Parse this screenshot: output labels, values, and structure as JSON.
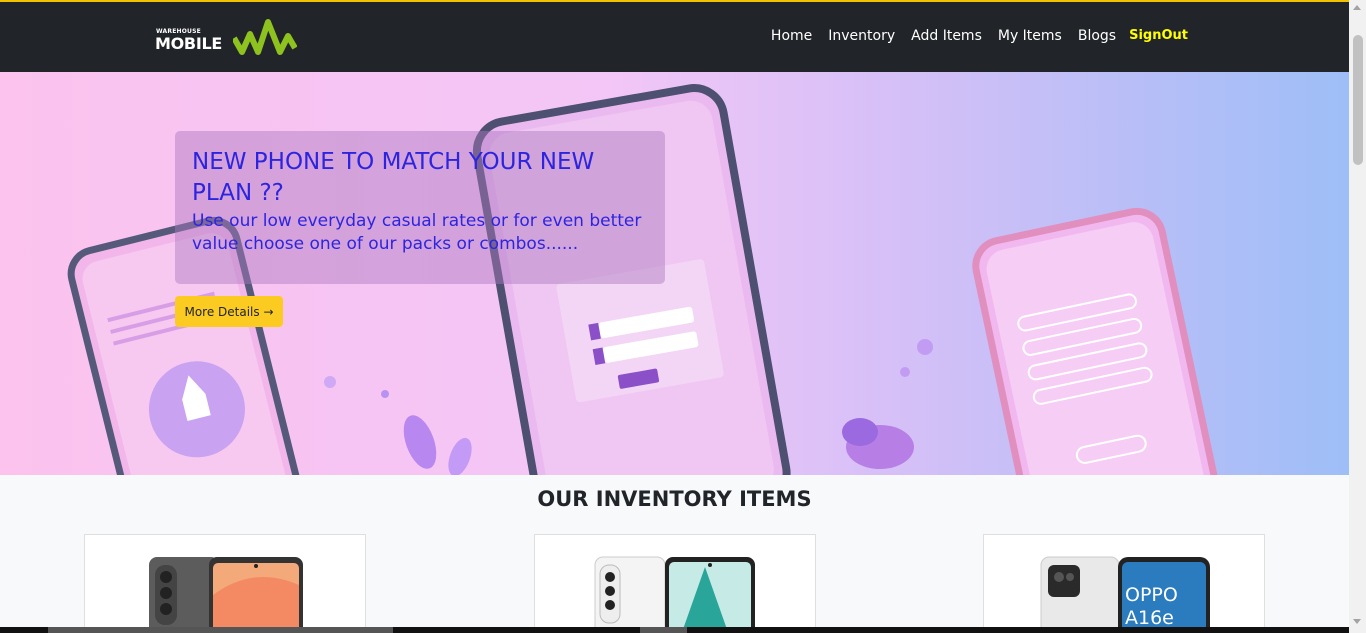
{
  "brand": {
    "logo_small": "WAREHOUSE",
    "logo_big": "MOBILE",
    "accent_color": "#8dc21f"
  },
  "nav": {
    "items": [
      "Home",
      "Inventory",
      "Add Items",
      "My Items",
      "Blogs"
    ],
    "signout": "SignOut"
  },
  "hero": {
    "title": "NEW PHONE TO MATCH YOUR NEW PLAN ??",
    "subtitle": "Use our low everyday casual rates or for even better value choose one of our packs or combos......",
    "button": "More Details →"
  },
  "inventory": {
    "heading": "OUR INVENTORY ITEMS",
    "cards": [
      {
        "image": "samsung-phone-image"
      },
      {
        "image": "samsung-a-phone-image"
      },
      {
        "image": "oppo-a16e-phone-image",
        "screen_text": "OPPO A16e"
      }
    ]
  },
  "colors": {
    "navbar": "#212529",
    "signout": "#ffff00",
    "hero_text": "#2d24e0",
    "button": "#fbcb22"
  }
}
